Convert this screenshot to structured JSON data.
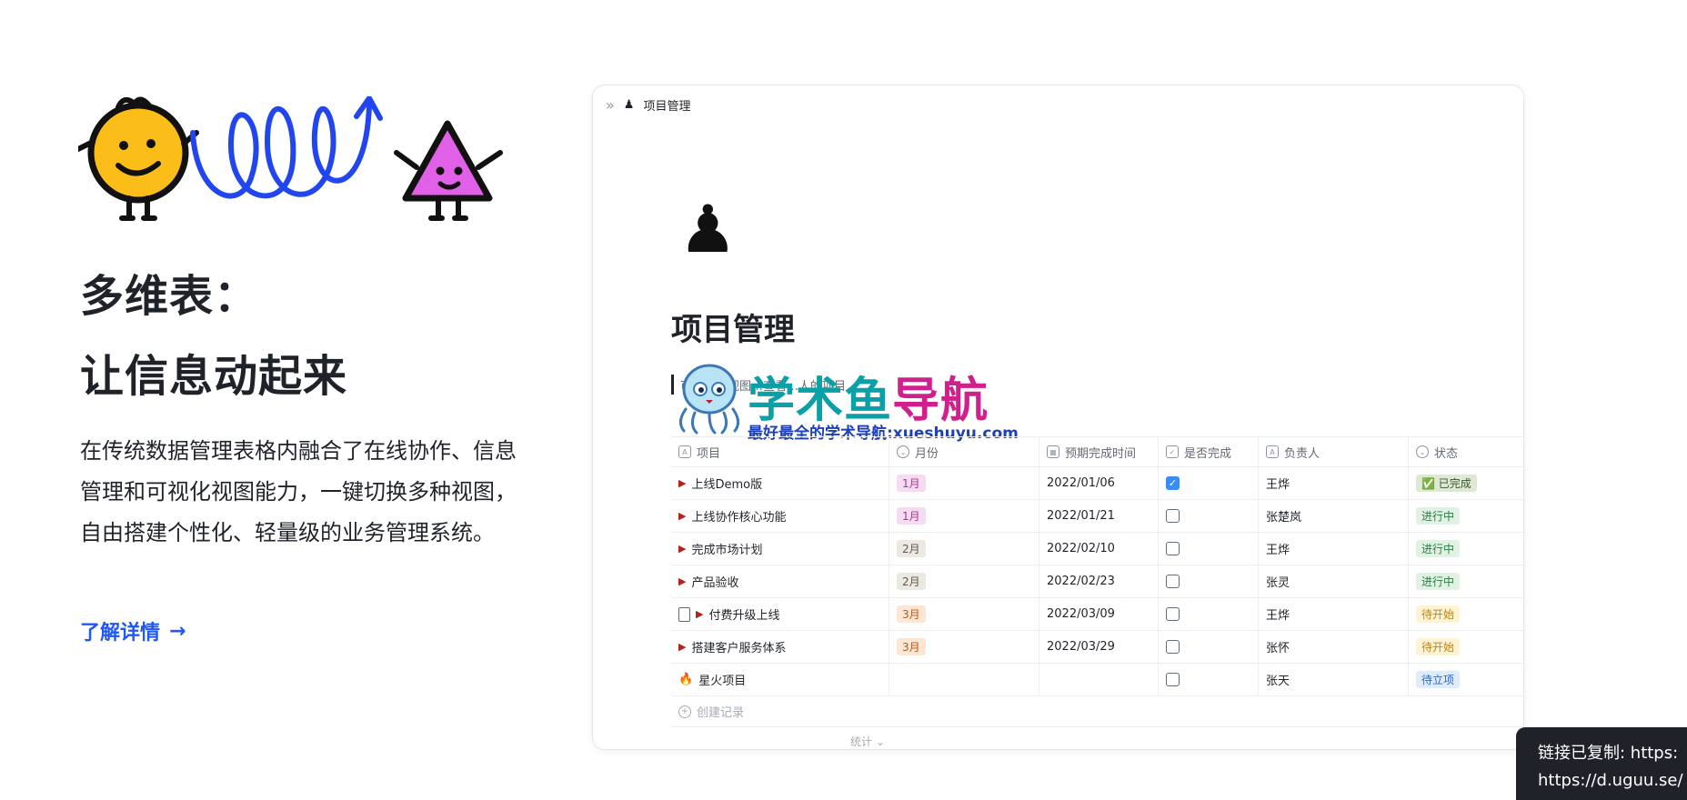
{
  "hero": {
    "title_line1": "多维表：",
    "title_line2": "让信息动起来",
    "description": "在传统数据管理表格内融合了在线协作、信息管理和可视化视图能力，一键切换多种视图，自由搭建个性化、轻量级的业务管理系统。",
    "link_label": "了解详情",
    "link_arrow": "→"
  },
  "card": {
    "breadcrumb_expand": "»",
    "breadcrumb_icon": "♟",
    "breadcrumb_title": "项目管理",
    "doc_icon": "♟",
    "doc_title": "项目管理",
    "hint": "可…看板视图…查看…人的项目",
    "columns": [
      {
        "label": "项目",
        "icon": "A"
      },
      {
        "label": "月份",
        "icon": "⌄"
      },
      {
        "label": "预期完成时间",
        "icon": "▦"
      },
      {
        "label": "是否完成",
        "icon": "✓"
      },
      {
        "label": "负责人",
        "icon": "A"
      },
      {
        "label": "状态",
        "icon": "⌄"
      }
    ],
    "rows": [
      {
        "name": "上线Demo版",
        "month": "1月",
        "date": "2022/01/06",
        "done": true,
        "owner": "王烨",
        "status": "✅ 已完成"
      },
      {
        "name": "上线协作核心功能",
        "month": "1月",
        "date": "2022/01/21",
        "done": false,
        "owner": "张楚岚",
        "status": "进行中"
      },
      {
        "name": "完成市场计划",
        "month": "2月",
        "date": "2022/02/10",
        "done": false,
        "owner": "王烨",
        "status": "进行中"
      },
      {
        "name": "产品验收",
        "month": "2月",
        "date": "2022/02/23",
        "done": false,
        "owner": "张灵",
        "status": "进行中"
      },
      {
        "name": "付费升级上线",
        "month": "3月",
        "date": "2022/03/09",
        "done": false,
        "owner": "王烨",
        "status": "待开始"
      },
      {
        "name": "搭建客户服务体系",
        "month": "3月",
        "date": "2022/03/29",
        "done": false,
        "owner": "张怀",
        "status": "待开始"
      },
      {
        "name": "星火项目",
        "month": "",
        "date": "",
        "done": false,
        "owner": "张天",
        "status": "待立项"
      }
    ],
    "add_record": "创建记录",
    "stats": "统计 ⌄"
  },
  "watermark": {
    "brand_a": "学术鱼",
    "brand_b": "导航",
    "tagline": "最好最全的学术导航:xueshuyu.com"
  },
  "toast": {
    "line1": "链接已复制: https:",
    "line2": "https://d.uguu.se/"
  },
  "colors": {
    "link": "#2157f2",
    "tag_1月": "#f6dcf0",
    "tag_2月": "#ece9e2",
    "tag_3月": "#fde6d4",
    "status_done": "#dfe7d7",
    "status_doing": "#e1f2e5",
    "status_todo": "#fff3d6",
    "status_plan": "#e1ecfb"
  }
}
